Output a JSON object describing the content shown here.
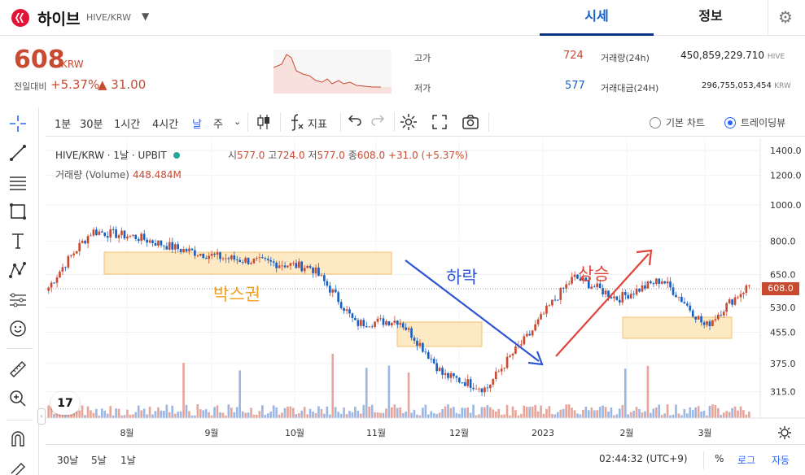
{
  "header": {
    "coin_name": "하이브",
    "coin_pair": "HIVE/KRW",
    "tabs": [
      {
        "label": "시세"
      },
      {
        "label": "정보"
      }
    ]
  },
  "price": {
    "current": "608",
    "unit": "KRW",
    "change_label": "전일대비",
    "change_rate": "+5.37%",
    "change_value": "▲ 31.00"
  },
  "stats": {
    "high_label": "고가",
    "high": "724",
    "low_label": "저가",
    "low": "577",
    "volume_label": "거래량(24h)",
    "volume": "450,859,229.710",
    "volume_unit": "HIVE",
    "amount_label": "거래대금(24H)",
    "amount": "296,755,053,454",
    "amount_unit": "KRW"
  },
  "toolbar": {
    "timeframes": [
      "1분",
      "30분",
      "1시간",
      "4시간",
      "날",
      "주"
    ],
    "active_timeframe": "날",
    "indicators_label": "지표",
    "basic_chart_label": "기본 차트",
    "tradingview_label": "트레이딩뷰"
  },
  "chart_header": {
    "symbol": "HIVE/KRW · 1날 · UPBIT",
    "open_label": "시",
    "open": "577.0",
    "high_label": "고",
    "high": "724.0",
    "low_label": "저",
    "low": "577.0",
    "close_label": "종",
    "close": "608.0",
    "change": "+31.0 (+5.37%)",
    "volume_label": "거래량 (Volume)",
    "volume_value": "448.484M",
    "last_price_tag": "608.0"
  },
  "annotations": {
    "box": "박스권",
    "fall": "하락",
    "rise": "상승"
  },
  "bottom": {
    "ranges": [
      "30날",
      "5날",
      "1날"
    ],
    "clock": "02:44:32 (UTC+9)",
    "percent": "%",
    "log": "로그",
    "auto": "자동"
  },
  "colors": {
    "up": "#c84a31",
    "down": "#1761c4",
    "accent": "#2962ff",
    "box_fill": "#fde9c4",
    "box_stroke": "#f5c26b",
    "fall_arrow": "#2f55d4",
    "rise_arrow": "#e0443a",
    "brand": "#e31337"
  },
  "chart_data": {
    "type": "candlestick",
    "x_ticks": [
      "8월",
      "9월",
      "10월",
      "11월",
      "12월",
      "2023",
      "2월",
      "3월"
    ],
    "y_ticks": [
      1400,
      1200,
      1000,
      800,
      650,
      530,
      455,
      375,
      315
    ],
    "y_scale": "log",
    "ylim": [
      280,
      1450
    ],
    "last_price": 608,
    "close_path_by_month": [
      {
        "x": "7월 말",
        "close": 600
      },
      {
        "x": "8월 초",
        "close": 850
      },
      {
        "x": "8월",
        "close": 820
      },
      {
        "x": "9월",
        "close": 760
      },
      {
        "x": "10월",
        "close": 720
      },
      {
        "x": "10월 말",
        "close": 700
      },
      {
        "x": "11월 초",
        "close": 680
      },
      {
        "x": "11월 중",
        "close": 480
      },
      {
        "x": "12월",
        "close": 490
      },
      {
        "x": "12월 말",
        "close": 350
      },
      {
        "x": "2023",
        "close": 320
      },
      {
        "x": "1월 말",
        "close": 450
      },
      {
        "x": "2월",
        "close": 640
      },
      {
        "x": "2월 말",
        "close": 560
      },
      {
        "x": "3월",
        "close": 630
      },
      {
        "x": "3월 중",
        "close": 470
      },
      {
        "x": "3월 말",
        "close": 608
      }
    ]
  }
}
